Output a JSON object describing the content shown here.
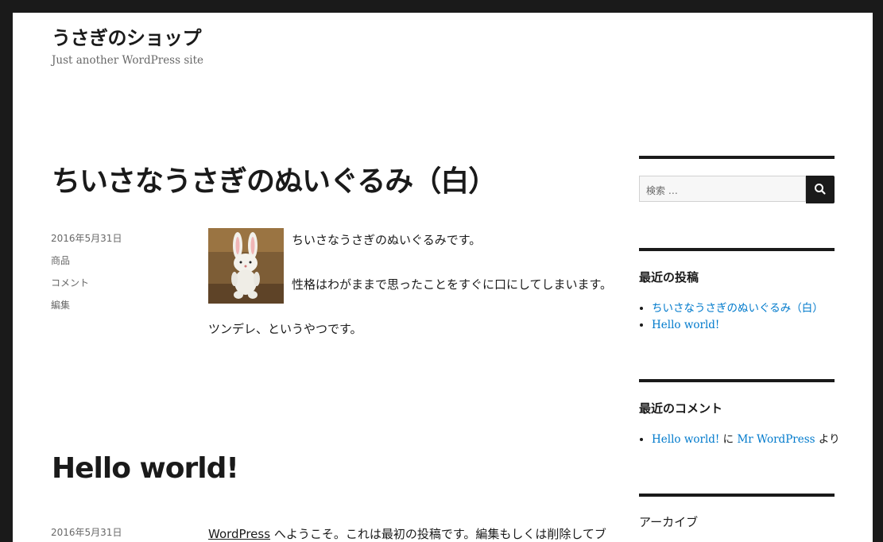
{
  "site": {
    "title": "うさぎのショップ",
    "description": "Just another WordPress site"
  },
  "posts": [
    {
      "title": "ちいさなうさぎのぬいぐるみ（白）",
      "meta": {
        "date": "2016年5月31日",
        "category": "商品",
        "comments": "コメント",
        "edit": "編集"
      },
      "content": [
        "ちいさなうさぎのぬいぐるみです。",
        "性格はわがままで思ったことをすぐに口にしてしまいます。",
        "ツンデレ、というやつです。"
      ]
    },
    {
      "title": "Hello world!",
      "meta": {
        "date": "2016年5月31日"
      },
      "content_link": "WordPress",
      "content_rest": " へようこそ。これは最初の投稿です。編集もしくは削除してブ"
    }
  ],
  "sidebar": {
    "search": {
      "placeholder": "検索 …"
    },
    "recent_posts": {
      "title": "最近の投稿",
      "items": [
        "ちいさなうさぎのぬいぐるみ（白）",
        "Hello world!"
      ]
    },
    "recent_comments": {
      "title": "最近のコメント",
      "items": [
        {
          "post": "Hello world!",
          "connector": " に ",
          "author": "Mr WordPress",
          "suffix": " より"
        }
      ]
    },
    "archives": {
      "title": "アーカイブ"
    }
  },
  "colors": {
    "link": "#007acc",
    "text": "#1a1a1a",
    "muted": "#686868",
    "frame": "#1a1a1a"
  }
}
